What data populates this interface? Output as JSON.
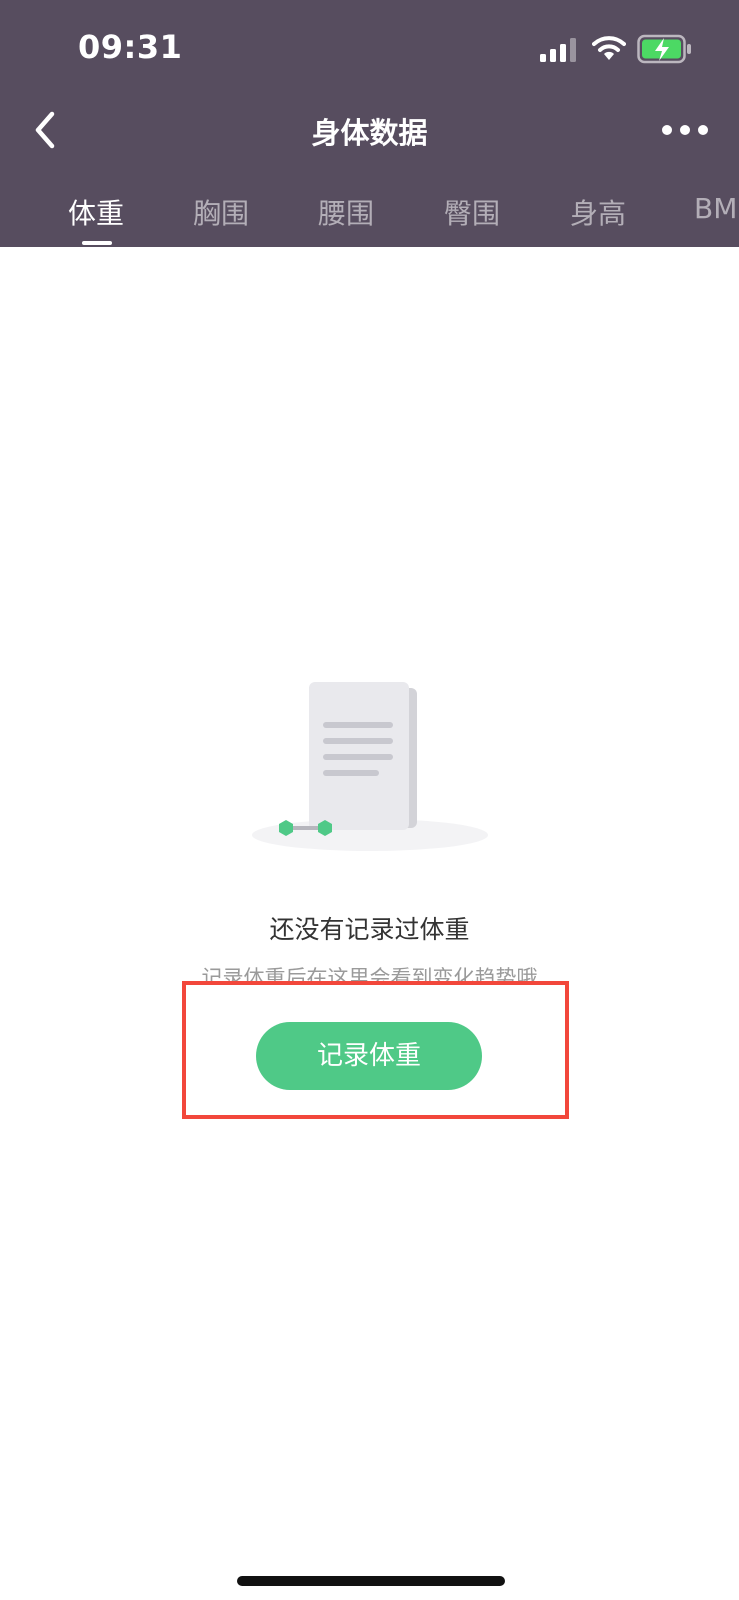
{
  "status_bar": {
    "time": "09:31",
    "icons": [
      "signal-icon",
      "wifi-icon",
      "battery-charging-icon"
    ],
    "battery_color": "#4cd964"
  },
  "nav": {
    "title": "身体数据",
    "back_icon": "chevron-left-icon",
    "more_icon": "more-dots-icon"
  },
  "tabs": [
    "体重",
    "胸围",
    "腰围",
    "臀围",
    "身高",
    "BMI"
  ],
  "active_tab": "体重",
  "empty_state": {
    "illustration": "document-and-dumbbell-illustration",
    "title": "还没有记录过体重",
    "subtitle": "记录体重后在这里会看到变化趋势哦"
  },
  "record_button_label": "记录体重",
  "colors": {
    "header_bg": "#574d5f",
    "accent": "#4fc987",
    "highlight_border": "#f2473b"
  }
}
